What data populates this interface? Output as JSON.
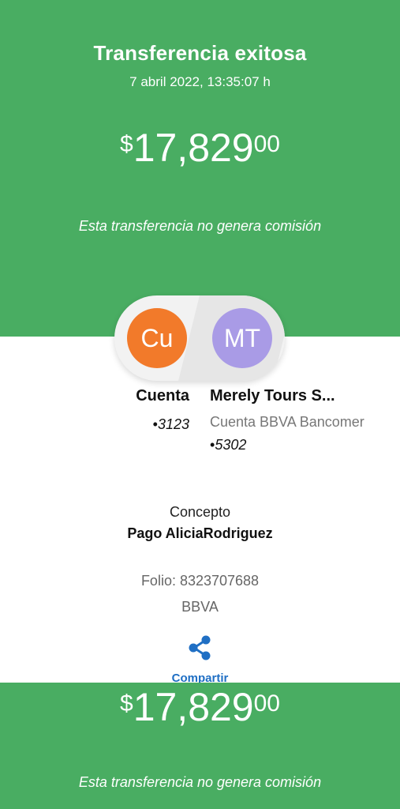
{
  "header": {
    "title": "Transferencia exitosa",
    "date": "7 abril 2022, 13:35:07 h"
  },
  "amount": {
    "currency": "$",
    "integer": "17,829",
    "decimals": "00"
  },
  "commission_note": "Esta transferencia no genera comisión",
  "from": {
    "initials": "Cu",
    "name": "Cuenta",
    "account_dot": "•",
    "account_last4": "3123",
    "avatar_color": "#f27a2a"
  },
  "to": {
    "initials": "MT",
    "name": "Merely Tours S...",
    "bank": "Cuenta BBVA Bancomer",
    "account_dot": "•",
    "account_last4": "5302",
    "avatar_color": "#a99be6"
  },
  "concept": {
    "label": "Concepto",
    "value": "Pago AliciaRodriguez"
  },
  "folio": "Folio: 8323707688",
  "bank_name": "BBVA",
  "share": {
    "icon": "share-icon",
    "label": "Compartir"
  },
  "colors": {
    "success_green": "#49ad62",
    "link_blue": "#1f6fc4"
  }
}
